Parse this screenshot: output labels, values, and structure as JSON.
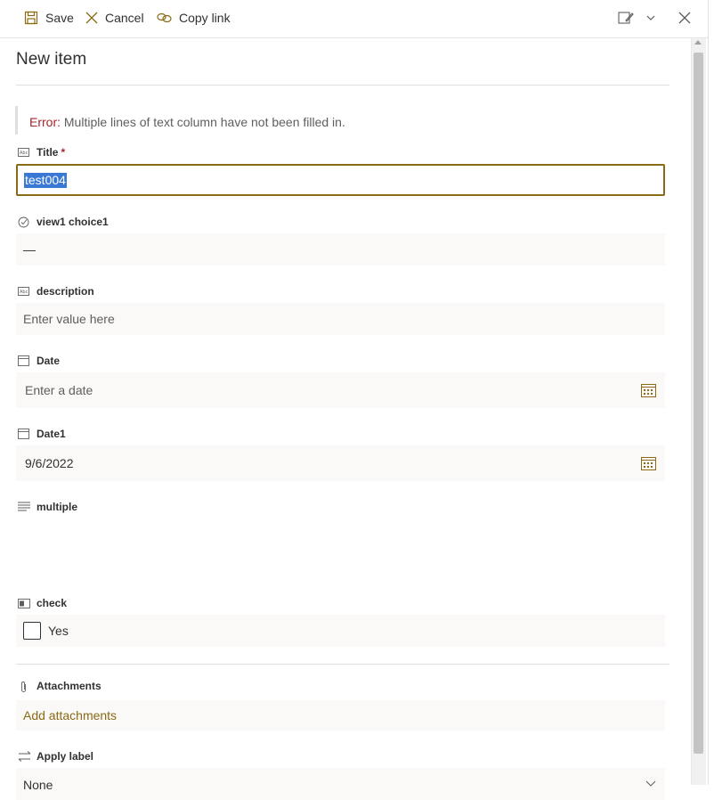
{
  "toolbar": {
    "save_label": "Save",
    "cancel_label": "Cancel",
    "copy_link_label": "Copy link"
  },
  "page": {
    "title": "New item"
  },
  "error": {
    "label": "Error:",
    "message": " Multiple lines of text column have not been filled in."
  },
  "fields": {
    "title": {
      "label": "Title",
      "required_mark": "*",
      "value": "test004"
    },
    "choice": {
      "label": "view1 choice1",
      "value": "—"
    },
    "description": {
      "label": "description",
      "placeholder": "Enter value here"
    },
    "date": {
      "label": "Date",
      "placeholder": "Enter a date"
    },
    "date1": {
      "label": "Date1",
      "value": "9/6/2022"
    },
    "multiple": {
      "label": "multiple"
    },
    "check": {
      "label": "check",
      "option": "Yes"
    },
    "attachments": {
      "label": "Attachments",
      "action": "Add attachments"
    },
    "apply_label": {
      "label": "Apply label",
      "value": "None"
    }
  },
  "colors": {
    "accent": "#8a6a15",
    "error": "#a4262c",
    "selection": "#3a78d6"
  }
}
